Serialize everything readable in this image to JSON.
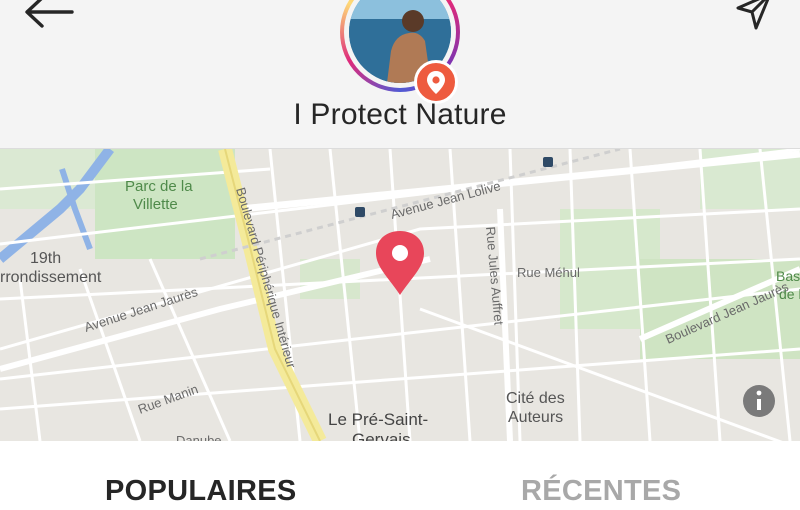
{
  "header": {
    "back_icon": "arrow-left-icon",
    "share_icon": "paper-plane-icon",
    "location_name": "I Protect Nature",
    "badge_icon": "location-pin-icon"
  },
  "map": {
    "info_icon": "info-icon",
    "pin_color": "#e8465a",
    "labels": {
      "parc": "Parc de la",
      "parc2": "Villette",
      "arr1": "19th",
      "arr2": "rrondissement",
      "jean_lolive": "Avenue Jean Lolive",
      "periph": "Boulevard Périphérique Intérieur",
      "jules_auffret": "Rue Jules Auffret",
      "mehul": "Rue Méhul",
      "jean_jaures_left": "Avenue Jean Jaurès",
      "jean_jaures_right": "Boulevard Jean Jaurès",
      "base1": "Base",
      "base2": "de l",
      "manin": "Rue Manin",
      "cite1": "Cité des",
      "cite2": "Auteurs",
      "pre1": "Le Pré-Saint-",
      "pre2": "Gervais",
      "danube": "Danube"
    }
  },
  "tabs": {
    "popular": "POPULAIRES",
    "recent": "RÉCENTES"
  }
}
